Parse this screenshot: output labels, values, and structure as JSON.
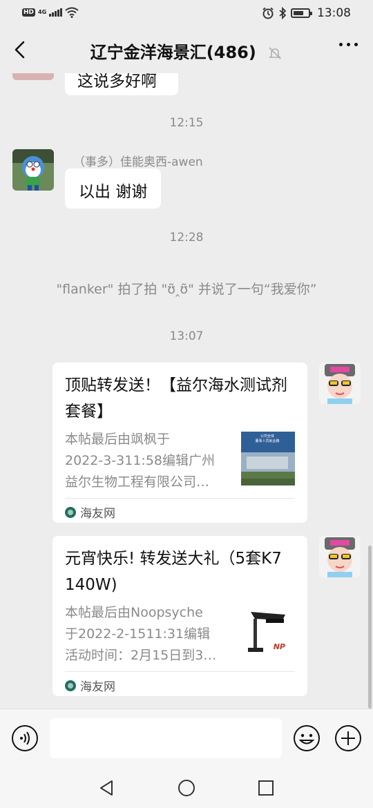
{
  "status_bar": {
    "hd": "HD",
    "network": "4G",
    "time": "13:08"
  },
  "nav": {
    "title": "辽宁金洋海景汇(486)",
    "back_icon": "chevron-left-icon",
    "mute_icon": "bell-muted-icon",
    "more_icon": "more-dots-icon"
  },
  "messages": {
    "partial_text": "这说多好啊",
    "ts1": "12:15",
    "msg1": {
      "sender": "（事多）佳能奥西-awen",
      "text": "以出 谢谢"
    },
    "ts2": "12:28",
    "system_text": "\"flanker\" 拍了拍 \"ʊ̃‸ʊ̃\" 并说了一句“我爱你”",
    "ts3": "13:07",
    "card1": {
      "title": "顶贴转发送！【益尔海水测试剂套餐】",
      "desc_line1": "本帖最后由飒枫于",
      "desc_line2": "2022-3-311:58编辑广州",
      "desc_line3": "益尔生物工程有限公司…",
      "thumb_text_1": "公司全体",
      "thumb_text_2": "董事人员就业路",
      "source": "海友网"
    },
    "card2": {
      "title": "元宵快乐! 转发送大礼（5套K7  140W)",
      "desc_line1": "本帖最后由Noopsyche",
      "desc_line2": "于2022-2-1511:31编辑",
      "desc_line3": "活动时间：2月15日到3…",
      "thumb_brand": "NP",
      "source": "海友网"
    }
  },
  "input_bar": {
    "placeholder": "",
    "voice_icon": "voice-icon",
    "emoji_icon": "emoji-icon",
    "plus_icon": "plus-icon"
  },
  "system_nav": {
    "back_icon": "triangle-back-icon",
    "home_icon": "circle-home-icon",
    "recents_icon": "square-recents-icon"
  },
  "colors": {
    "background": "#ededed",
    "bubble": "#ffffff",
    "meta_text": "#8a8a8a"
  }
}
